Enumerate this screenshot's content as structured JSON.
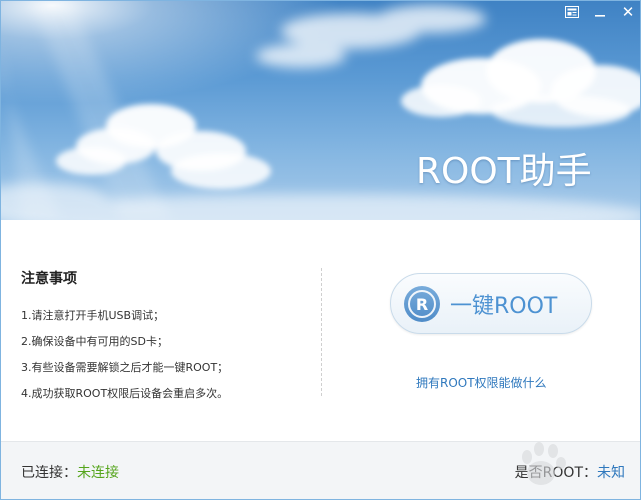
{
  "window": {
    "title": "ROOT助手",
    "controls": [
      {
        "name": "skin-icon"
      },
      {
        "name": "minimize-icon"
      },
      {
        "name": "close-icon",
        "glyph": "✕"
      }
    ]
  },
  "notes": {
    "title": "注意事项",
    "items": [
      "1.请注意打开手机USB调试；",
      "2.确保设备中有可用的SD卡；",
      "3.有些设备需要解锁之后才能一键ROOT；",
      "4.成功获取ROOT权限后设备会重启多次。"
    ]
  },
  "action": {
    "logo_letter": "R",
    "button_label": "一键ROOT",
    "link_text": "拥有ROOT权限能做什么"
  },
  "status": {
    "connected_label": "已连接：",
    "connected_value": "未连接",
    "root_label": "是否ROOT：",
    "root_value": "未知"
  },
  "colors": {
    "accent_blue": "#2f78bd",
    "status_green": "#55a51c",
    "sky_top": "#3f82c4"
  }
}
